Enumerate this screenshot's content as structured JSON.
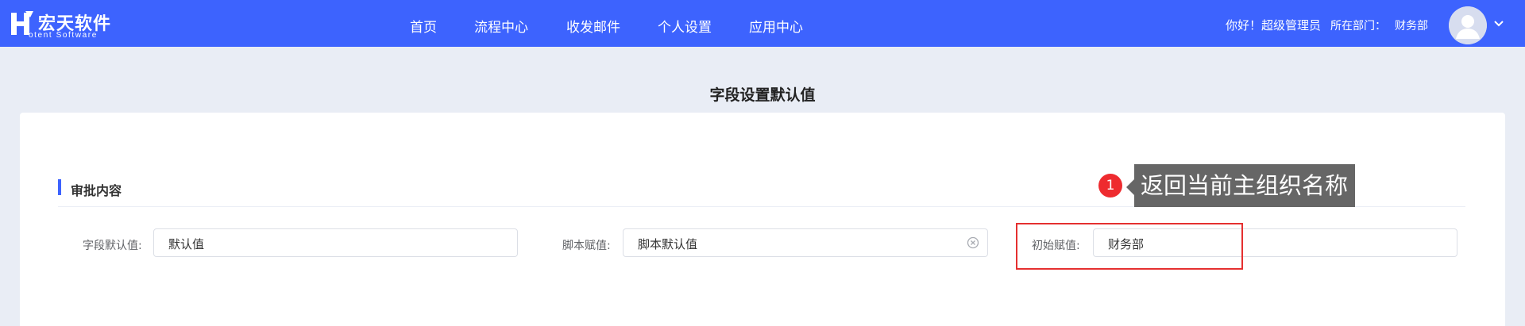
{
  "header": {
    "logo_name": "宏天软件",
    "logo_sub": "otent Software",
    "nav": [
      "首页",
      "流程中心",
      "收发邮件",
      "个人设置",
      "应用中心"
    ],
    "greeting": "你好！超级管理员",
    "dept_label": "所在部门：",
    "dept_value": "财务部"
  },
  "page": {
    "title": "字段设置默认值",
    "section_title": "审批内容",
    "fields": [
      {
        "label": "字段默认值:",
        "value": "默认值"
      },
      {
        "label": "脚本赋值:",
        "value": "脚本默认值"
      },
      {
        "label": "初始赋值:",
        "value": "财务部"
      }
    ]
  },
  "annotation": {
    "badge": "1",
    "tooltip": "返回当前主组织名称",
    "highlight_color": "#e53030"
  },
  "colors": {
    "brand": "#3d63fe",
    "background": "#e9edf5"
  }
}
